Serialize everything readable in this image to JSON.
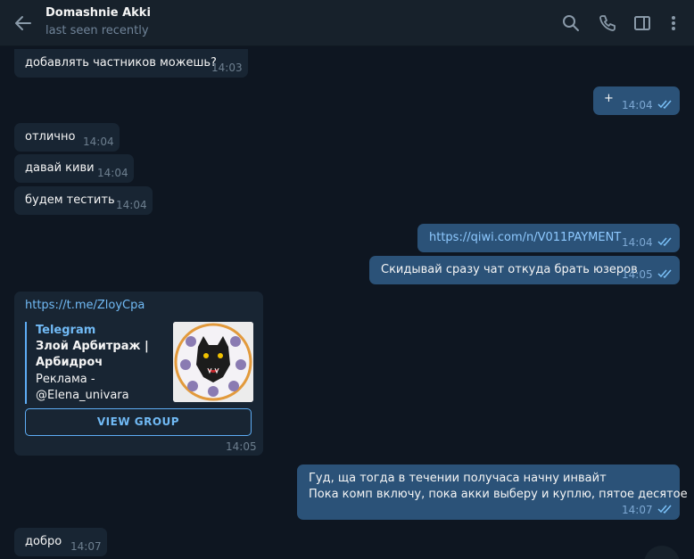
{
  "header": {
    "title": "Domashnie Akki",
    "status": "last seen recently",
    "icons": [
      "back-arrow-icon",
      "search-icon",
      "phone-icon",
      "sidebar-icon",
      "more-icon"
    ]
  },
  "messages": [
    {
      "dir": "in",
      "text": "добавлять частников можешь?",
      "time": "14:03"
    },
    {
      "dir": "out",
      "text": "+",
      "time": "14:04",
      "read": true
    },
    {
      "dir": "in",
      "text": "отлично",
      "time": "14:04"
    },
    {
      "dir": "in",
      "text": "давай киви",
      "time": "14:04"
    },
    {
      "dir": "in",
      "text": "будем тестить",
      "time": "14:04"
    },
    {
      "dir": "out",
      "text": "https://qiwi.com/n/V011PAYMENT",
      "time": "14:04",
      "read": true
    },
    {
      "dir": "out",
      "text": "Скидывай сразу чат откуда брать юзеров",
      "time": "14:05",
      "read": true
    },
    {
      "dir": "in",
      "text": "https://t.me/ZloyCpa",
      "time": "14:05",
      "preview": {
        "site": "Telegram",
        "title": "Злой Арбитраж | Арбидроч",
        "description": "Реклама - @Elena_univara",
        "button": "VIEW GROUP"
      }
    },
    {
      "dir": "out",
      "lines": [
        "Гуд, ща тогда в течении получаса начну инвайт",
        "Пока комп включу, пока акки выберу и куплю, пятое десятое"
      ],
      "time": "14:07",
      "read": true
    },
    {
      "dir": "in",
      "text": "добро",
      "time": "14:07"
    }
  ],
  "colors": {
    "background": "#0e1621",
    "header": "#17212b",
    "incoming": "#182533",
    "outgoing": "#2b5278",
    "link": "#71baf5"
  }
}
